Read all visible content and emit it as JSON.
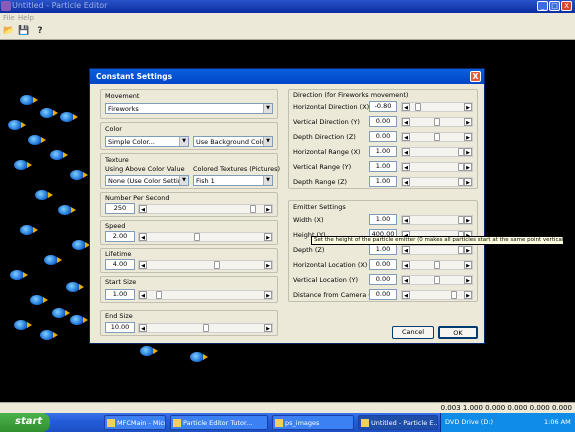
{
  "window": {
    "title": "Untitled - Particle Editor",
    "min": "_",
    "max": "□",
    "close": "X"
  },
  "menu": {
    "file": "File",
    "help": "Help"
  },
  "toolbar": {
    "open": "📂",
    "save": "💾",
    "help": "?"
  },
  "status": {
    "values": "0.003 1.000 0.000 0.000 0.000 0.000"
  },
  "taskbar": {
    "start": "start",
    "tasks": [
      "MFCMain - Microsof...",
      "Particle Editor Tutor...",
      "ps_images",
      "Untitled - Particle E...",
      "DVD Drive (D:)"
    ],
    "clock": "1:06 AM"
  },
  "dialog": {
    "title": "Constant Settings",
    "close": "X",
    "movement": {
      "label": "Movement",
      "value": "Fireworks"
    },
    "color": {
      "label": "Color",
      "type": "Simple Color...",
      "bg": "Use Background Color..."
    },
    "texture": {
      "label": "Texture",
      "left_label": "Using Above Color Value",
      "left_value": "None (Use Color Settings)",
      "right_label": "Colored Textures (Pictures)",
      "right_value": "Fish 1"
    },
    "nps": {
      "label": "Number Per Second",
      "value": "250",
      "fraction": 0.93
    },
    "speed": {
      "label": "Speed",
      "value": "2.00",
      "fraction": 0.42
    },
    "lifetime": {
      "label": "Lifetime",
      "value": "4.00",
      "fraction": 0.6
    },
    "start_size": {
      "label": "Start Size",
      "value": "1.00",
      "fraction": 0.08
    },
    "end_size": {
      "label": "End Size",
      "value": "10.00",
      "fraction": 0.5
    },
    "direction": {
      "label": "Direction (for Fireworks movement)",
      "rows": [
        {
          "label": "Horizontal Direction (X)",
          "value": "-0.80",
          "fraction": 0.1
        },
        {
          "label": "Vertical Direction (Y)",
          "value": "0.00",
          "fraction": 0.5
        },
        {
          "label": "Depth Direction (Z)",
          "value": "0.00",
          "fraction": 0.5
        },
        {
          "label": "Horizontal Range (X)",
          "value": "1.00",
          "fraction": 1.0
        },
        {
          "label": "Vertical Range (Y)",
          "value": "1.00",
          "fraction": 1.0
        },
        {
          "label": "Depth Range (Z)",
          "value": "1.00",
          "fraction": 1.0
        }
      ]
    },
    "emitter": {
      "label": "Emitter Settings",
      "rows": [
        {
          "label": "Width (X)",
          "value": "1.00",
          "fraction": 1.0
        },
        {
          "label": "Height (Y)",
          "value": "400.00",
          "fraction": 1.0
        },
        {
          "label": "Depth (Z)",
          "value": "1.00",
          "fraction": 1.0
        },
        {
          "label": "Horizontal Location (X)",
          "value": "0.00",
          "fraction": 0.5
        },
        {
          "label": "Vertical Location (Y)",
          "value": "0.00",
          "fraction": 0.5
        },
        {
          "label": "Distance from Camera (Z)",
          "value": "0.00",
          "fraction": 0.85
        }
      ]
    },
    "tooltip": "Set the height of the particle emitter (0 makes all particles start at the same point vertically)",
    "cancel": "Cancel",
    "ok": "OK"
  },
  "colors": {
    "titlebar": "#0a2ea0",
    "dialog_title": "#0046c8",
    "taskbar": "#245edb",
    "start": "#2f8f2f"
  }
}
